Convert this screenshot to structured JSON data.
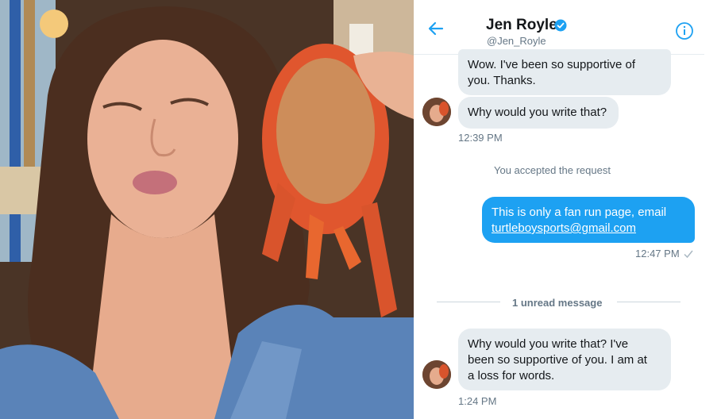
{
  "header": {
    "name": "Jen Royle",
    "handle": "@Jen_Royle",
    "back_icon": "arrow-left-icon",
    "info_icon": "info-icon",
    "verified_icon": "verified-badge-icon"
  },
  "messages": {
    "m1": {
      "line1": "Wow. I've been so supportive of",
      "line2": "you. Thanks."
    },
    "m2": {
      "text": "Why would you write that?",
      "time": "12:39 PM"
    },
    "system": "You accepted the request",
    "m3": {
      "line1": "This is only a fan run page, email",
      "link": "turtleboysports@gmail.com",
      "time": "12:47 PM"
    },
    "unread": "1 unread message",
    "m4": {
      "line1": "Why would you write that? I've",
      "line2": "been so supportive of you. I am at",
      "line3": "a loss for words.",
      "time": "1:24 PM"
    }
  },
  "colors": {
    "accent": "#1da1f2",
    "incoming_bubble": "#e6ecf0",
    "secondary_text": "#657786"
  }
}
